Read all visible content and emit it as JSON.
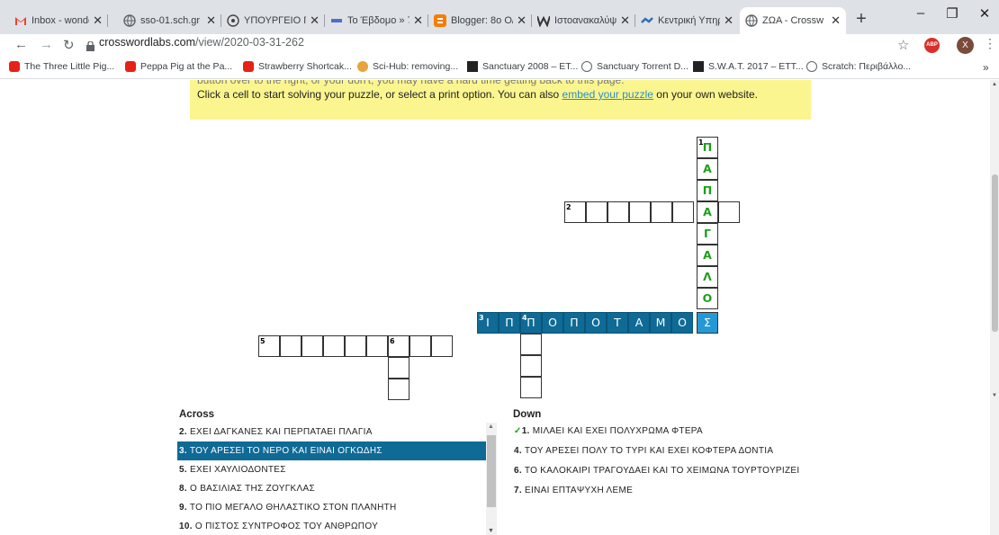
{
  "browser": {
    "tabs": [
      {
        "title": "Inbox - wonde",
        "icon": "gmail-icon"
      },
      {
        "title": "sso-01.sch.gr",
        "icon": "globe-icon"
      },
      {
        "title": "ΥΠΟΥΡΓΕΙΟ Π",
        "icon": "ministry-icon"
      },
      {
        "title": "Το Έβδομο » 7",
        "icon": "blog-icon"
      },
      {
        "title": "Blogger: 8ο Ο/",
        "icon": "blogger-icon"
      },
      {
        "title": "Ιστοανακαλύψ",
        "icon": "w-icon"
      },
      {
        "title": "Κεντρική Υπηρ",
        "icon": "site-icon"
      },
      {
        "title": "ΖΩΑ - Crossw",
        "icon": "globe-icon"
      }
    ],
    "new_tab": "+",
    "window_controls": [
      "–",
      "❐",
      "✕"
    ],
    "url_host": "crosswordlabs.com",
    "url_path": "/view/2020-03-31-262",
    "bookmarks": [
      "The Three Little Pig...",
      "Peppa Pig at the Pa...",
      "Strawberry Shortcak...",
      "Sci-Hub: removing...",
      "Sanctuary 2008 – ET...",
      "Sanctuary Torrent D...",
      "S.W.A.T. 2017 – ETT...",
      "Scratch: Περιβάλλο..."
    ],
    "more_bookmarks": "»",
    "profile_initial": "X",
    "abp": "ABP"
  },
  "notice": {
    "line0": "button over to the right, or your don't, you may have a hard time getting back to this page.",
    "text1": "Click a cell to start solving your puzzle, or select a print option. You can also ",
    "link": "embed your puzzle",
    "text2": " on your own website."
  },
  "grid": {
    "word1_letters": [
      "Π",
      "Α",
      "Π",
      "Α",
      "Γ",
      "Α",
      "Λ",
      "Ο",
      "Σ"
    ],
    "word3_letters": [
      "Ι",
      "Π",
      "Π",
      "Ο",
      "Π",
      "Ο",
      "Τ",
      "Α",
      "Μ",
      "Ο",
      "Σ"
    ],
    "numbers": {
      "n1": "1",
      "n2": "2",
      "n3": "3",
      "n4": "4",
      "n5": "5",
      "n6": "6"
    }
  },
  "clues": {
    "across_heading": "Across",
    "down_heading": "Down",
    "across": [
      {
        "num": "2.",
        "text": "ΕΧΕΙ ΔΑΓΚΑΝΕΣ ΚΑΙ ΠΕΡΠΑΤΑΕΙ ΠΛΑΓΙΑ"
      },
      {
        "num": "3.",
        "text": "ΤΟΥ ΑΡΕΣΕΙ ΤΟ ΝΕΡΟ ΚΑΙ ΕΙΝΑΙ ΟΓΚΩΔΗΣ"
      },
      {
        "num": "5.",
        "text": "ΕΧΕΙ ΧΑΥΛΙΟΔΟΝΤΕΣ"
      },
      {
        "num": "8.",
        "text": "Ο ΒΑΣΙΛΙΑΣ ΤΗΣ ΖΟΥΓΚΛΑΣ"
      },
      {
        "num": "9.",
        "text": "ΤΟ ΠΙΟ ΜΕΓΑΛΟ ΘΗΛΑΣΤΙΚΟ ΣΤΟΝ ΠΛΑΝΗΤΗ"
      },
      {
        "num": "10.",
        "text": "Ο ΠΙΣΤΟΣ ΣΥΝΤΡΟΦΟΣ ΤΟΥ ΑΝΘΡΩΠΟΥ"
      }
    ],
    "down": [
      {
        "check": "✓",
        "num": "1.",
        "text": "ΜΙΛΑΕΙ ΚΑΙ ΕΧΕΙ ΠΟΛΥΧΡΩΜΑ ΦΤΕΡΑ"
      },
      {
        "check": "",
        "num": "4.",
        "text": "ΤΟΥ ΑΡΕΣΕΙ ΠΟΛΥ ΤΟ ΤΥΡΙ ΚΑΙ ΕΧΕΙ ΚΟΦΤΕΡΑ ΔΟΝΤΙΑ"
      },
      {
        "check": "",
        "num": "6.",
        "text": "ΤΟ ΚΑΛΟΚΑΙΡΙ ΤΡΑΓΟΥΔΑΕΙ ΚΑΙ ΤΟ ΧΕΙΜΩΝΑ ΤΟΥΡΤΟΥΡΙΖΕΙ"
      },
      {
        "check": "",
        "num": "7.",
        "text": "ΕΙΝΑΙ ΕΠΤΑΨΥΧΗ ΛΕΜΕ"
      }
    ]
  },
  "colors": {
    "highlight": "#0f6a96",
    "selected": "#2499d6",
    "correct": "#1ca01c",
    "notice_bg": "#fbf58f"
  }
}
